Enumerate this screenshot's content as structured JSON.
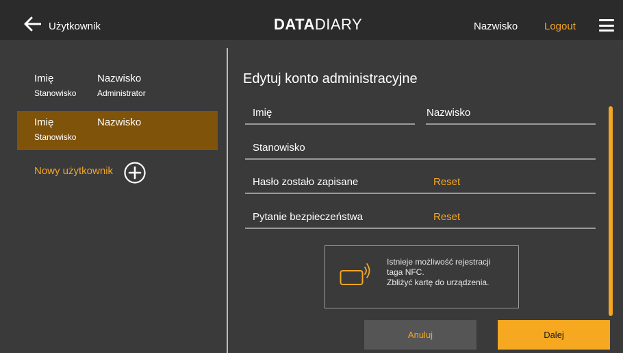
{
  "header": {
    "back_label": "Użytkownik",
    "logo_bold": "DATA",
    "logo_thin": "DIARY",
    "user_name": "Nazwisko",
    "logout_label": "Logout"
  },
  "icons": {
    "back": "arrow-left-icon",
    "menu": "hamburger-menu-icon",
    "add": "plus-circle-icon",
    "nfc": "nfc-card-icon"
  },
  "sidebar": {
    "users": [
      {
        "first_name": "Imię",
        "last_name": "Nazwisko",
        "position": "Stanowisko",
        "role": "Administrator",
        "selected": false
      },
      {
        "first_name": "Imię",
        "last_name": "Nazwisko",
        "position": "Stanowisko",
        "role": "",
        "selected": true
      }
    ],
    "new_user_label": "Nowy użytkownik"
  },
  "form": {
    "title": "Edytuj konto administracyjne",
    "first_name_label": "Imię",
    "last_name_label": "Nazwisko",
    "position_label": "Stanowisko",
    "password_label": "Hasło zostało zapisane",
    "password_action": "Reset",
    "security_label": "Pytanie bezpieczeństwa",
    "security_action": "Reset"
  },
  "nfc": {
    "line1": "Istnieje możliwość rejestracji",
    "line2": "taga NFC.",
    "line3": "Zbliżyć kartę do urządzenia."
  },
  "buttons": {
    "cancel": "Anuluj",
    "next": "Dalej"
  },
  "colors": {
    "accent": "#f5a623",
    "selected_row": "#80530b",
    "background": "#3a3a3a",
    "header": "#2b2b2b"
  }
}
